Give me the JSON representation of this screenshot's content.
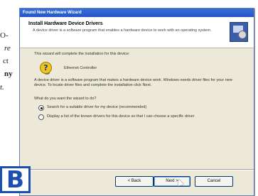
{
  "document": {
    "fragments": [
      "O-",
      "re",
      "ct",
      "ny",
      "t."
    ]
  },
  "wizard": {
    "title": "Found New Hardware Wizard",
    "header_title": "Install Hardware Device Drivers",
    "header_subtitle": "A device driver is a software program that enables a hardware device to work with an operating system.",
    "intro": "This wizard will complete the installation for this device:",
    "device_name": "Ethernet Controller",
    "paragraph": "A device driver is a software program that makes a hardware device work. Windows needs driver files for your new device. To locate driver files and complete the installation click Next.",
    "question": "What do you want the wizard to do?",
    "options": [
      {
        "label": "Search for a suitable driver for my device (recommended)",
        "selected": true
      },
      {
        "label": "Display a list of the known drivers for this device so that I can choose a specific driver",
        "selected": false
      }
    ],
    "buttons": {
      "back": "< Back",
      "next": "Next >",
      "cancel": "Cancel"
    }
  },
  "figure_label": "B",
  "colors": {
    "label_blue": "#1e4fb0",
    "titlebar": "#2355c8",
    "dialog_bg": "#ece9d8"
  }
}
